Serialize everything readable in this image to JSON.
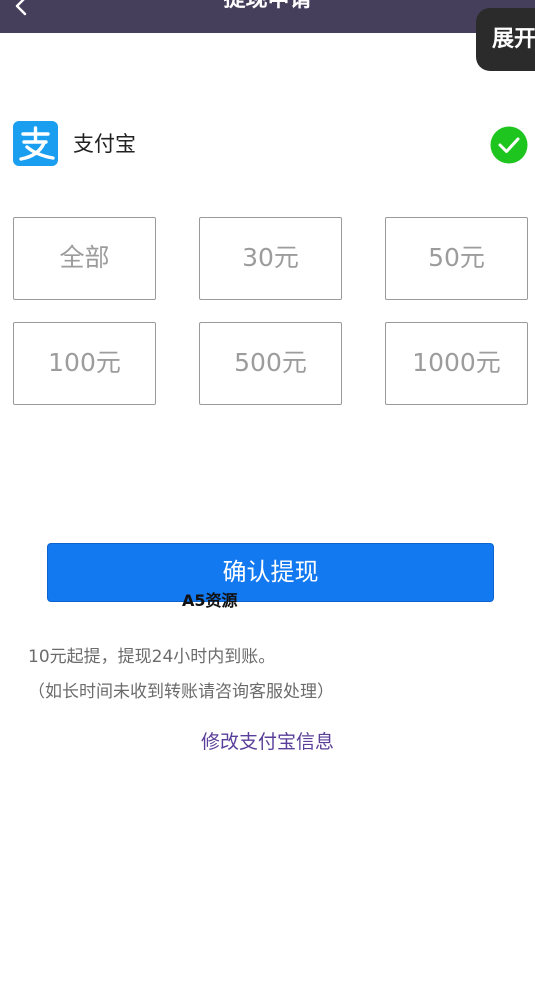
{
  "header": {
    "title": "提现申请",
    "expand_label": "展开"
  },
  "payment": {
    "method_name": "支付宝",
    "selected": true
  },
  "amounts": [
    "全部",
    "30元",
    "50元",
    "100元",
    "500元",
    "1000元"
  ],
  "confirm_label": "确认提现",
  "watermark": "A5资源",
  "notes": {
    "line1": "10元起提，提现24小时内到账。",
    "line2": "（如长时间未收到转账请咨询客服处理）"
  },
  "edit_link": "修改支付宝信息",
  "colors": {
    "header_bg": "#463f5c",
    "primary": "#1379f1",
    "alipay": "#1a9ef0",
    "success": "#1ec51e",
    "link": "#5a3f9a"
  }
}
